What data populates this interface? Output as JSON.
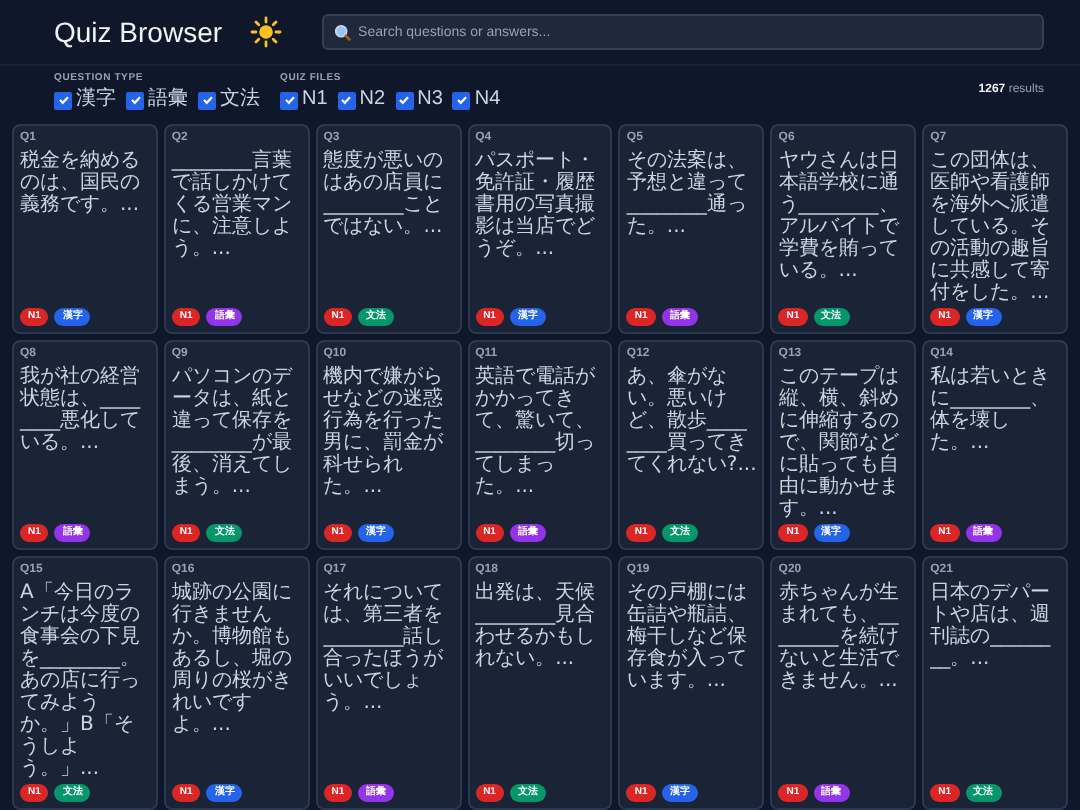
{
  "header": {
    "title": "Quiz Browser",
    "search": {
      "placeholder": "Search questions or answers..."
    }
  },
  "filters": {
    "groups": [
      {
        "label": "QUESTION TYPE",
        "options": [
          {
            "label": "漢字",
            "checked": true
          },
          {
            "label": "語彙",
            "checked": true
          },
          {
            "label": "文法",
            "checked": true
          }
        ]
      },
      {
        "label": "QUIZ FILES",
        "options": [
          {
            "label": "N1",
            "checked": true
          },
          {
            "label": "N2",
            "checked": true
          },
          {
            "label": "N3",
            "checked": true
          },
          {
            "label": "N4",
            "checked": true
          }
        ]
      }
    ],
    "count": "1267",
    "count_label": "results"
  },
  "cards": [
    {
      "id": "Q1",
      "text": "税金を納めるのは、国民の義務です。...",
      "tags": [
        {
          "label": "N1",
          "color": "#dc2626"
        },
        {
          "label": "漢字",
          "color": "#2563eb"
        }
      ]
    },
    {
      "id": "Q2",
      "text": "________言葉で話しかけてくる営業マンに、注意しよう。...",
      "tags": [
        {
          "label": "N1",
          "color": "#dc2626"
        },
        {
          "label": "語彙",
          "color": "#9333ea"
        }
      ]
    },
    {
      "id": "Q3",
      "text": "態度が悪いのはあの店員に________ことではない。...",
      "tags": [
        {
          "label": "N1",
          "color": "#dc2626"
        },
        {
          "label": "文法",
          "color": "#059669"
        }
      ]
    },
    {
      "id": "Q4",
      "text": "パスポート・免許証・履歴書用の写真撮影は当店でどうぞ。...",
      "tags": [
        {
          "label": "N1",
          "color": "#dc2626"
        },
        {
          "label": "漢字",
          "color": "#2563eb"
        }
      ]
    },
    {
      "id": "Q5",
      "text": "その法案は、予想と違って________通った。...",
      "tags": [
        {
          "label": "N1",
          "color": "#dc2626"
        },
        {
          "label": "語彙",
          "color": "#9333ea"
        }
      ]
    },
    {
      "id": "Q6",
      "text": "ヤウさんは日本語学校に通う________、アルバイトで学費を賄っている。...",
      "tags": [
        {
          "label": "N1",
          "color": "#dc2626"
        },
        {
          "label": "文法",
          "color": "#059669"
        }
      ]
    },
    {
      "id": "Q7",
      "text": "この団体は、医師や看護師を海外へ派遣している。その活動の趣旨に共感して寄付をした。...",
      "tags": [
        {
          "label": "N1",
          "color": "#dc2626"
        },
        {
          "label": "漢字",
          "color": "#2563eb"
        }
      ]
    },
    {
      "id": "Q8",
      "text": "我が社の経営状態は、________悪化している。...",
      "tags": [
        {
          "label": "N1",
          "color": "#dc2626"
        },
        {
          "label": "語彙",
          "color": "#9333ea"
        }
      ]
    },
    {
      "id": "Q9",
      "text": "パソコンのデータは、紙と違って保存を________が最後、消えてしまう。...",
      "tags": [
        {
          "label": "N1",
          "color": "#dc2626"
        },
        {
          "label": "文法",
          "color": "#059669"
        }
      ]
    },
    {
      "id": "Q10",
      "text": "機内で嫌がらせなどの迷惑行為を行った男に、罰金が科せられた。...",
      "tags": [
        {
          "label": "N1",
          "color": "#dc2626"
        },
        {
          "label": "漢字",
          "color": "#2563eb"
        }
      ]
    },
    {
      "id": "Q11",
      "text": "英語で電話がかかってきて、驚いて、________切ってしまった。...",
      "tags": [
        {
          "label": "N1",
          "color": "#dc2626"
        },
        {
          "label": "語彙",
          "color": "#9333ea"
        }
      ]
    },
    {
      "id": "Q12",
      "text": "あ、傘がない。悪いけど、散歩________買ってきてくれない?...",
      "tags": [
        {
          "label": "N1",
          "color": "#dc2626"
        },
        {
          "label": "文法",
          "color": "#059669"
        }
      ]
    },
    {
      "id": "Q13",
      "text": "このテープは縦、横、斜めに伸縮するので、関節などに貼っても自由に動かせます。...",
      "tags": [
        {
          "label": "N1",
          "color": "#dc2626"
        },
        {
          "label": "漢字",
          "color": "#2563eb"
        }
      ]
    },
    {
      "id": "Q14",
      "text": "私は若いときに________、体を壊した。...",
      "tags": [
        {
          "label": "N1",
          "color": "#dc2626"
        },
        {
          "label": "語彙",
          "color": "#9333ea"
        }
      ]
    },
    {
      "id": "Q15",
      "text": "A「今日のランチは今度の食事会の下見を________。あの店に行ってみようか。」B「そうしよう。」...",
      "tags": [
        {
          "label": "N1",
          "color": "#dc2626"
        },
        {
          "label": "文法",
          "color": "#059669"
        }
      ]
    },
    {
      "id": "Q16",
      "text": "城跡の公園に行きませんか。博物館もあるし、堀の周りの桜がきれいですよ。...",
      "tags": [
        {
          "label": "N1",
          "color": "#dc2626"
        },
        {
          "label": "漢字",
          "color": "#2563eb"
        }
      ]
    },
    {
      "id": "Q17",
      "text": "それについては、第三者を________話し合ったほうがいいでしょう。...",
      "tags": [
        {
          "label": "N1",
          "color": "#dc2626"
        },
        {
          "label": "語彙",
          "color": "#9333ea"
        }
      ]
    },
    {
      "id": "Q18",
      "text": "出発は、天候________見合わせるかもしれない。...",
      "tags": [
        {
          "label": "N1",
          "color": "#dc2626"
        },
        {
          "label": "文法",
          "color": "#059669"
        }
      ]
    },
    {
      "id": "Q19",
      "text": "その戸棚には缶詰や瓶詰、梅干しなど保存食が入っています。...",
      "tags": [
        {
          "label": "N1",
          "color": "#dc2626"
        },
        {
          "label": "漢字",
          "color": "#2563eb"
        }
      ]
    },
    {
      "id": "Q20",
      "text": "赤ちゃんが生まれても、________を続けないと生活できません。...",
      "tags": [
        {
          "label": "N1",
          "color": "#dc2626"
        },
        {
          "label": "語彙",
          "color": "#9333ea"
        }
      ]
    },
    {
      "id": "Q21",
      "text": "日本のデパートや店は、週刊誌の________。...",
      "tags": [
        {
          "label": "N1",
          "color": "#dc2626"
        },
        {
          "label": "文法",
          "color": "#059669"
        }
      ]
    }
  ]
}
